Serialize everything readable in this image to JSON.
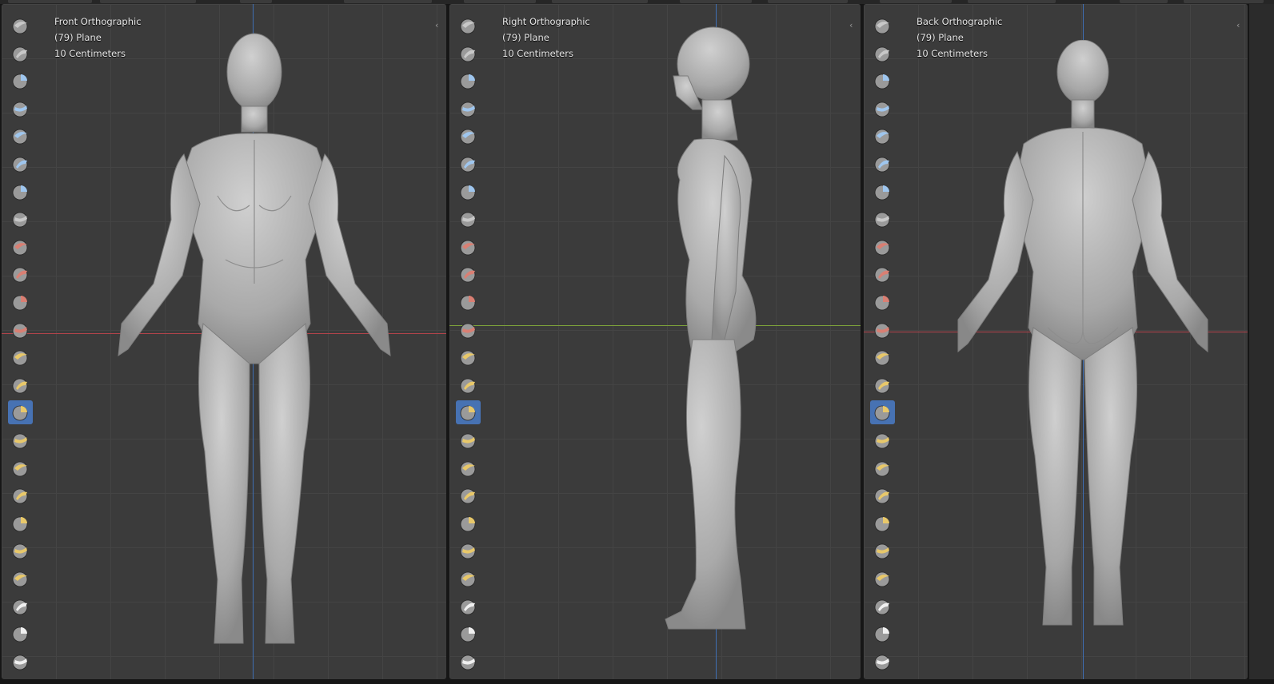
{
  "colors": {
    "viewport_bg": "#3b3b3b",
    "grid": "#444444",
    "x_axis": "#b3434b",
    "y_axis": "#7ea33a",
    "z_axis": "#3f6fb4",
    "active_tool": "#4772b3",
    "brush_grey": "#c8c8c8",
    "brush_blue": "#9fc6ee",
    "brush_red": "#d97f73",
    "brush_yellow": "#e8c86a"
  },
  "viewports": [
    {
      "view_name": "Front Orthographic",
      "object": "(79) Plane",
      "scale": "10 Centimeters",
      "horizontal_axis": "x-axis",
      "view": "front"
    },
    {
      "view_name": "Right Orthographic",
      "object": "(79) Plane",
      "scale": "10 Centimeters",
      "horizontal_axis": "y-axis",
      "view": "side"
    },
    {
      "view_name": "Back Orthographic",
      "object": "(79) Plane",
      "scale": "10 Centimeters",
      "horizontal_axis": "x-axis",
      "view": "back"
    }
  ],
  "tools": [
    {
      "icon": "draw-brush-icon",
      "color": "grey"
    },
    {
      "icon": "draw-sharp-brush-icon",
      "color": "grey"
    },
    {
      "icon": "clay-brush-icon",
      "color": "blue"
    },
    {
      "icon": "clay-strips-brush-icon",
      "color": "blue"
    },
    {
      "icon": "clay-thumb-brush-icon",
      "color": "blue"
    },
    {
      "icon": "layer-brush-icon",
      "color": "blue"
    },
    {
      "icon": "inflate-brush-icon",
      "color": "blue"
    },
    {
      "icon": "blob-brush-icon",
      "color": "grey"
    },
    {
      "icon": "crease-brush-icon",
      "color": "red"
    },
    {
      "icon": "smooth-brush-icon",
      "color": "red"
    },
    {
      "icon": "flatten-brush-icon",
      "color": "red"
    },
    {
      "icon": "fill-brush-icon",
      "color": "red"
    },
    {
      "icon": "scrape-brush-icon",
      "color": "yellow"
    },
    {
      "icon": "multiplane-scrape-brush-icon",
      "color": "yellow"
    },
    {
      "icon": "pinch-brush-icon",
      "color": "yellow",
      "active": true
    },
    {
      "icon": "grab-brush-icon",
      "color": "yellow"
    },
    {
      "icon": "elastic-deform-brush-icon",
      "color": "yellow"
    },
    {
      "icon": "snake-hook-brush-icon",
      "color": "yellow"
    },
    {
      "icon": "thumb-brush-icon",
      "color": "yellow"
    },
    {
      "icon": "pose-brush-icon",
      "color": "yellow"
    },
    {
      "icon": "nudge-brush-icon",
      "color": "yellow"
    },
    {
      "icon": "rotate-brush-icon",
      "color": "white"
    },
    {
      "icon": "slide-relax-brush-icon",
      "color": "white"
    },
    {
      "icon": "mask-brush-icon",
      "color": "white"
    }
  ]
}
